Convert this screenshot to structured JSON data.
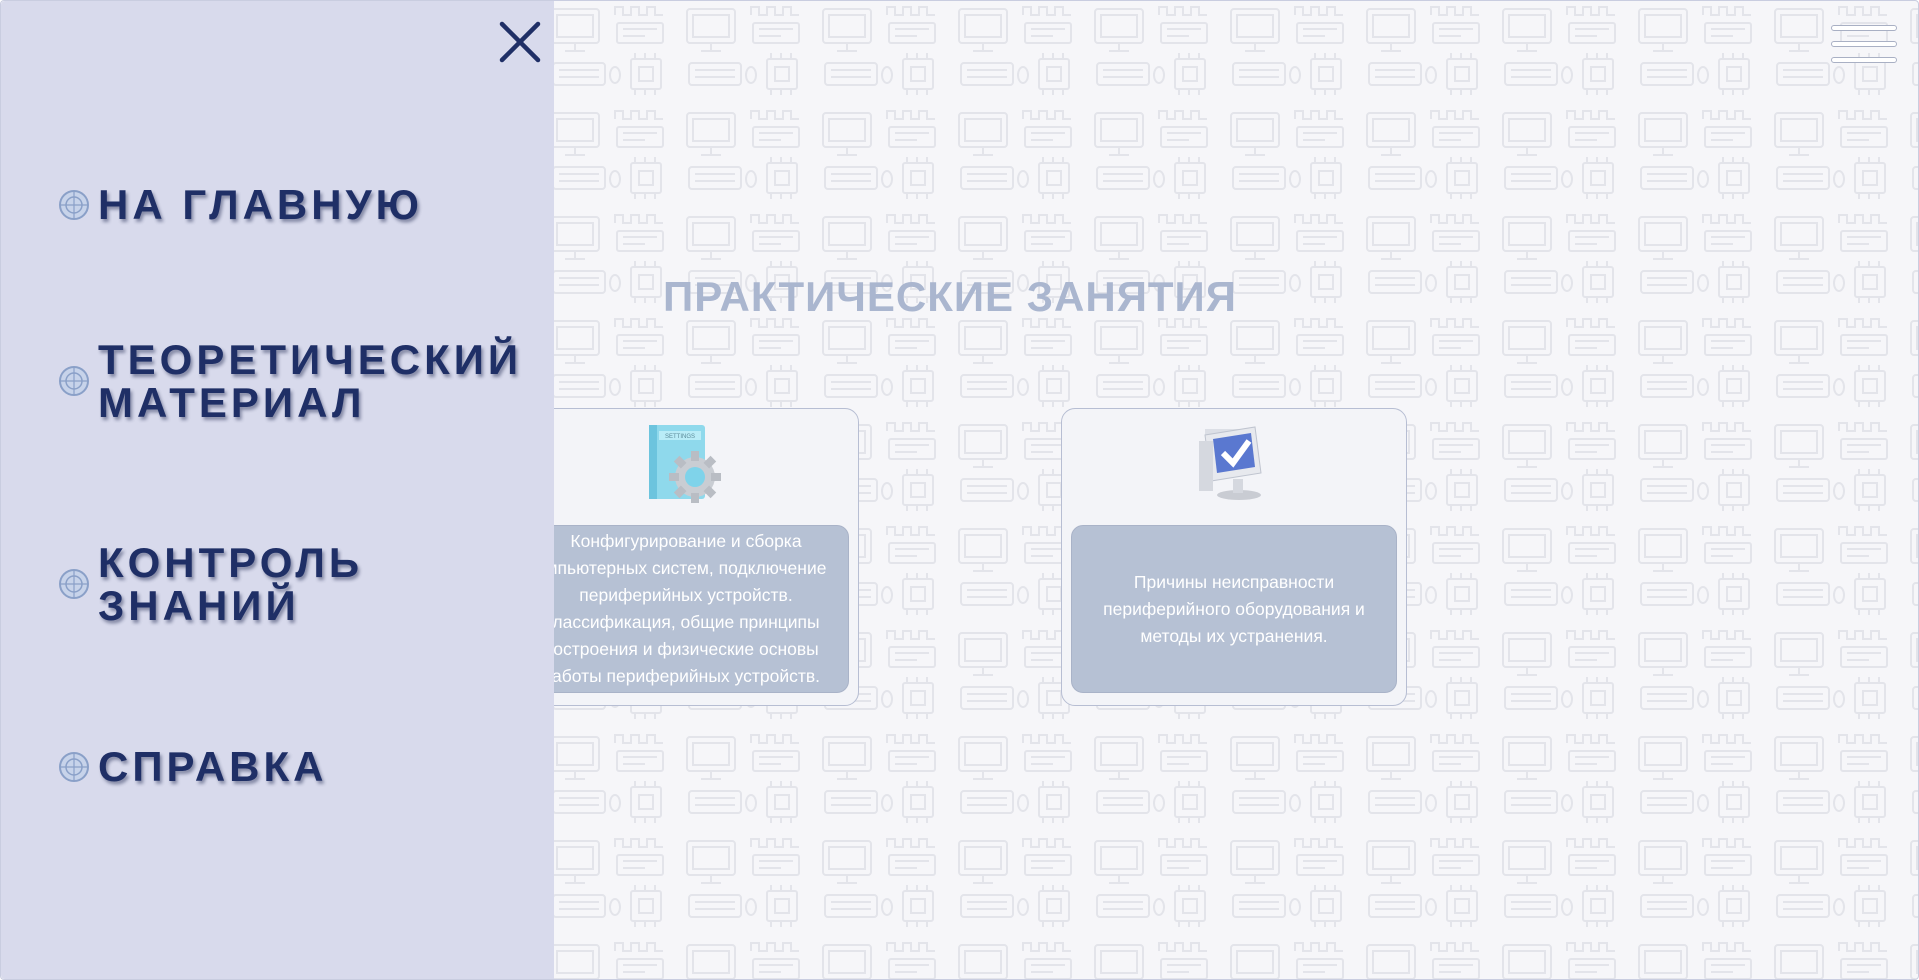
{
  "menu": {
    "items": [
      {
        "label": "НА ГЛАВНУЮ"
      },
      {
        "label": "ТЕОРЕТИЧЕСКИЙ\nМАТЕРИАЛ"
      },
      {
        "label": "КОНТРОЛЬ\nЗНАНИЙ"
      },
      {
        "label": "СПРАВКА"
      }
    ],
    "item_icon": "globe-icon",
    "close_icon": "close-icon"
  },
  "header": {
    "hamburger_icon": "hamburger-menu-icon"
  },
  "main": {
    "title": "ПРАКТИЧЕСКИЕ ЗАНЯТИЯ",
    "cards": [
      {
        "icon": "settings-book-icon",
        "image_label": "SETTINGS",
        "text": "Конфигурирование и сборка мпьютерных систем, подключение периферийных устройств. лассификация, общие принципы остроения и физические основы аботы периферийных устройств."
      },
      {
        "icon": "computer-check-icon",
        "text": "Причины неисправности периферийного оборудования и методы их устранения."
      }
    ]
  },
  "colors": {
    "menu_bg": "#d8daec",
    "menu_text": "#1f2f66",
    "title": "#aab6cf",
    "card_body": "#b6c1d4"
  }
}
